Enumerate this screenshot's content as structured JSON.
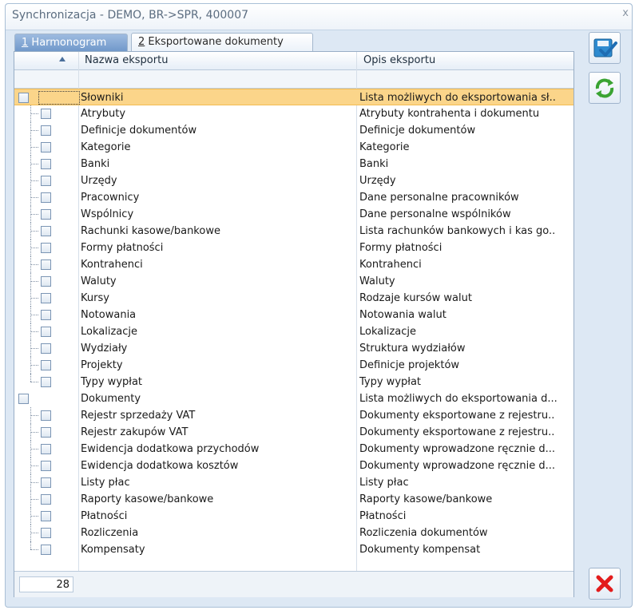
{
  "window": {
    "title": "Synchronizacja - DEMO, BR->SPR, 400007",
    "close_glyph": "x"
  },
  "tabs": [
    {
      "key": "1",
      "label": " Harmonogram"
    },
    {
      "key": "2",
      "label": " Eksportowane dokumenty"
    }
  ],
  "grid": {
    "columns": {
      "name": "Nazwa eksportu",
      "desc": "Opis eksportu"
    },
    "rows": [
      {
        "name": "Słowniki",
        "desc": "Lista możliwych do eksportowania sł..",
        "root": true,
        "selected": true
      },
      {
        "name": "Atrybuty",
        "desc": "Atrybuty kontrahenta i dokumentu"
      },
      {
        "name": "Definicje dokumentów",
        "desc": "Definicje dokumentów"
      },
      {
        "name": "Kategorie",
        "desc": "Kategorie"
      },
      {
        "name": "Banki",
        "desc": "Banki"
      },
      {
        "name": "Urzędy",
        "desc": "Urzędy"
      },
      {
        "name": "Pracownicy",
        "desc": "Dane personalne pracowników"
      },
      {
        "name": "Wspólnicy",
        "desc": "Dane personalne wspólników"
      },
      {
        "name": "Rachunki kasowe/bankowe",
        "desc": "Lista rachunków bankowych i kas go.."
      },
      {
        "name": "Formy płatności",
        "desc": "Formy płatności"
      },
      {
        "name": "Kontrahenci",
        "desc": "Kontrahenci"
      },
      {
        "name": "Waluty",
        "desc": "Waluty"
      },
      {
        "name": "Kursy",
        "desc": "Rodzaje kursów walut"
      },
      {
        "name": "Notowania",
        "desc": "Notowania walut"
      },
      {
        "name": "Lokalizacje",
        "desc": "Lokalizacje"
      },
      {
        "name": "Wydziały",
        "desc": "Struktura wydziałów"
      },
      {
        "name": "Projekty",
        "desc": "Definicje projektów"
      },
      {
        "name": "Typy wypłat",
        "desc": "Typy wypłat",
        "last": true
      },
      {
        "name": "Dokumenty",
        "desc": "Lista możliwych do eksportowania d...",
        "root": true
      },
      {
        "name": "Rejestr sprzedaży VAT",
        "desc": "Dokumenty eksportowane z rejestru.."
      },
      {
        "name": "Rejestr zakupów VAT",
        "desc": "Dokumenty eksportowane z rejestru.."
      },
      {
        "name": "Ewidencja dodatkowa przychodów",
        "desc": "Dokumenty wprowadzone ręcznie d..."
      },
      {
        "name": "Ewidencja dodatkowa kosztów",
        "desc": "Dokumenty wprowadzone ręcznie d..."
      },
      {
        "name": "Listy płac",
        "desc": "Listy płac"
      },
      {
        "name": "Raporty kasowe/bankowe",
        "desc": "Raporty kasowe/bankowe"
      },
      {
        "name": "Płatności",
        "desc": "Płatności"
      },
      {
        "name": "Rozliczenia",
        "desc": "Rozliczenia dokumentów"
      },
      {
        "name": "Kompensaty",
        "desc": "Dokumenty kompensat",
        "last": true
      }
    ],
    "footer_count": "28"
  },
  "buttons": {
    "save_icon": "save-check-icon",
    "refresh_icon": "refresh-icon",
    "cancel_icon": "cancel-icon"
  },
  "colors": {
    "selected_row": "#fbd58a",
    "accent": "#1a7fbf",
    "cancel": "#e31c1c",
    "refresh": "#3aa332"
  }
}
